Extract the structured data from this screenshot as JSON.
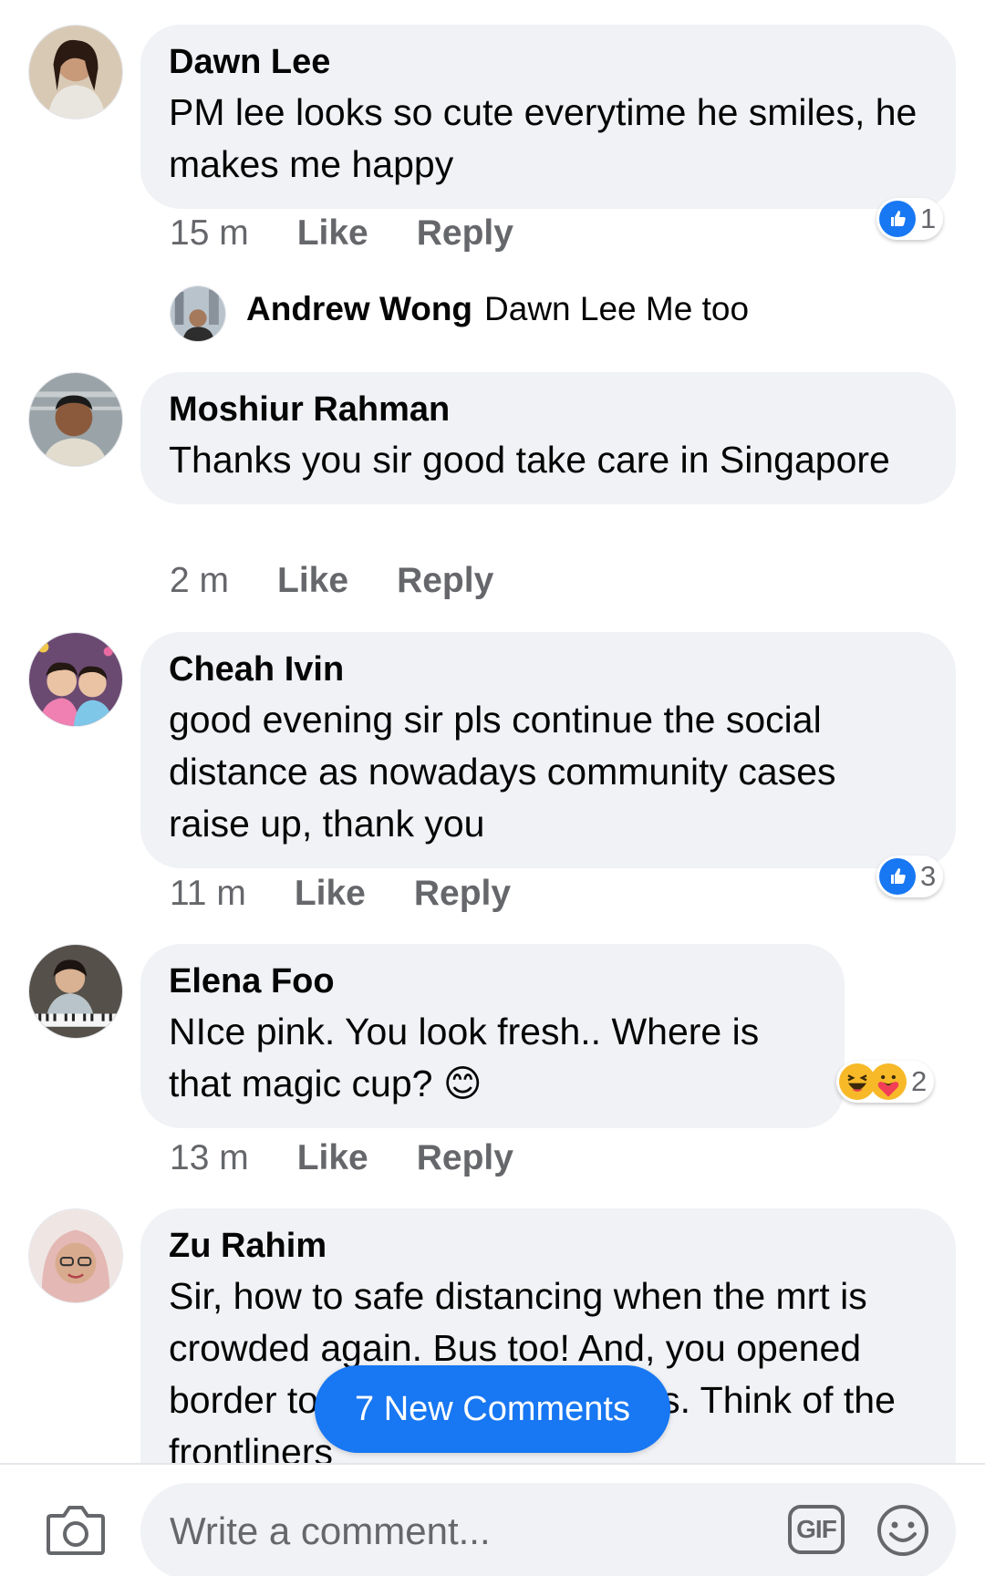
{
  "comments": [
    {
      "author": "Dawn Lee",
      "text": "PM lee looks so cute everytime he smiles, he makes me happy",
      "time": "15 m",
      "like": "Like",
      "reply": "Reply",
      "reaction_count": "1"
    },
    {
      "author": "Moshiur Rahman",
      "text": "Thanks you  sir good take care in Singapore",
      "time": "2 m",
      "like": "Like",
      "reply": "Reply"
    },
    {
      "author": "Cheah Ivin",
      "text": "good evening sir pls continue the social distance as nowadays community cases raise up, thank you",
      "time": "11 m",
      "like": "Like",
      "reply": "Reply",
      "reaction_count": "3"
    },
    {
      "author": "Elena Foo",
      "text": "NIce pink. You look fresh.. Where is that magic cup?",
      "time": "13 m",
      "like": "Like",
      "reply": "Reply",
      "reaction_count": "2",
      "emoji": "😊"
    },
    {
      "author": "Zu Rahim",
      "text": "Sir, how to safe distancing when the mrt is crowded again. Bus too! And, you opened border to China. Pls think of us. Think of the frontliners"
    }
  ],
  "reply_preview": {
    "author": "Andrew Wong",
    "text": "Dawn Lee Me too"
  },
  "new_comments_label": "7 New Comments",
  "composer": {
    "placeholder": "Write a comment...",
    "gif_label": "GIF"
  },
  "icons": {
    "like_reaction": "thumbs-up-icon",
    "haha_reaction": "laughing-face-icon",
    "care_reaction": "care-hug-icon",
    "camera": "camera-icon",
    "emoji": "smiley-face-icon"
  },
  "colors": {
    "brand_blue": "#1877f2",
    "bubble_bg": "#f0f2f5",
    "muted_text": "#65676b"
  }
}
